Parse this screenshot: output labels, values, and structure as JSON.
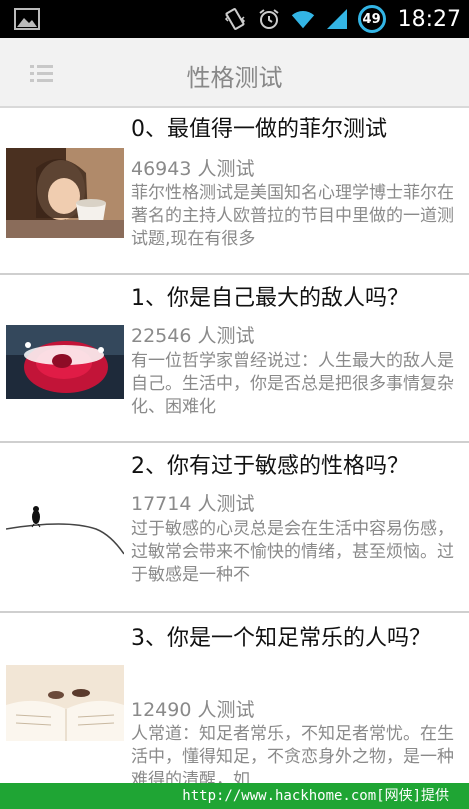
{
  "status_bar": {
    "time": "18:27",
    "battery_level": "49",
    "icons": [
      "image-icon",
      "vibrate-icon",
      "alarm-icon",
      "wifi-icon",
      "signal-icon",
      "battery-icon"
    ]
  },
  "header": {
    "title": "性格测试",
    "menu_icon": "menu-icon"
  },
  "items": [
    {
      "title": "0、最值得一做的菲尔测试",
      "count": "46943  人测试",
      "desc": "菲尔性格测试是美国知名心理学博士菲尔在著名的主持人欧普拉的节目中里做的一道测试题,现在有很多"
    },
    {
      "title": "1、你是自己最大的敌人吗？",
      "count": "22546  人测试",
      "desc": "有一位哲学家曾经说过：人生最大的敌人是自己。生活中，你是否总是把很多事情复杂化、困难化"
    },
    {
      "title": "2、你有过于敏感的性格吗？",
      "count": "17714  人测试",
      "desc": "过于敏感的心灵总是会在生活中容易伤感，过敏常会带来不愉快的情绪，甚至烦恼。过于敏感是一种不"
    },
    {
      "title": "3、你是一个知足常乐的人吗？",
      "count": "12490  人测试",
      "desc": "人常道：知足者常乐，不知足者常忧。在生活中，懂得知足，不贪恋身外之物，是一种难得的清醒，如"
    }
  ],
  "footer": {
    "text": "http://www.hackhome.com[网侠]提供"
  }
}
